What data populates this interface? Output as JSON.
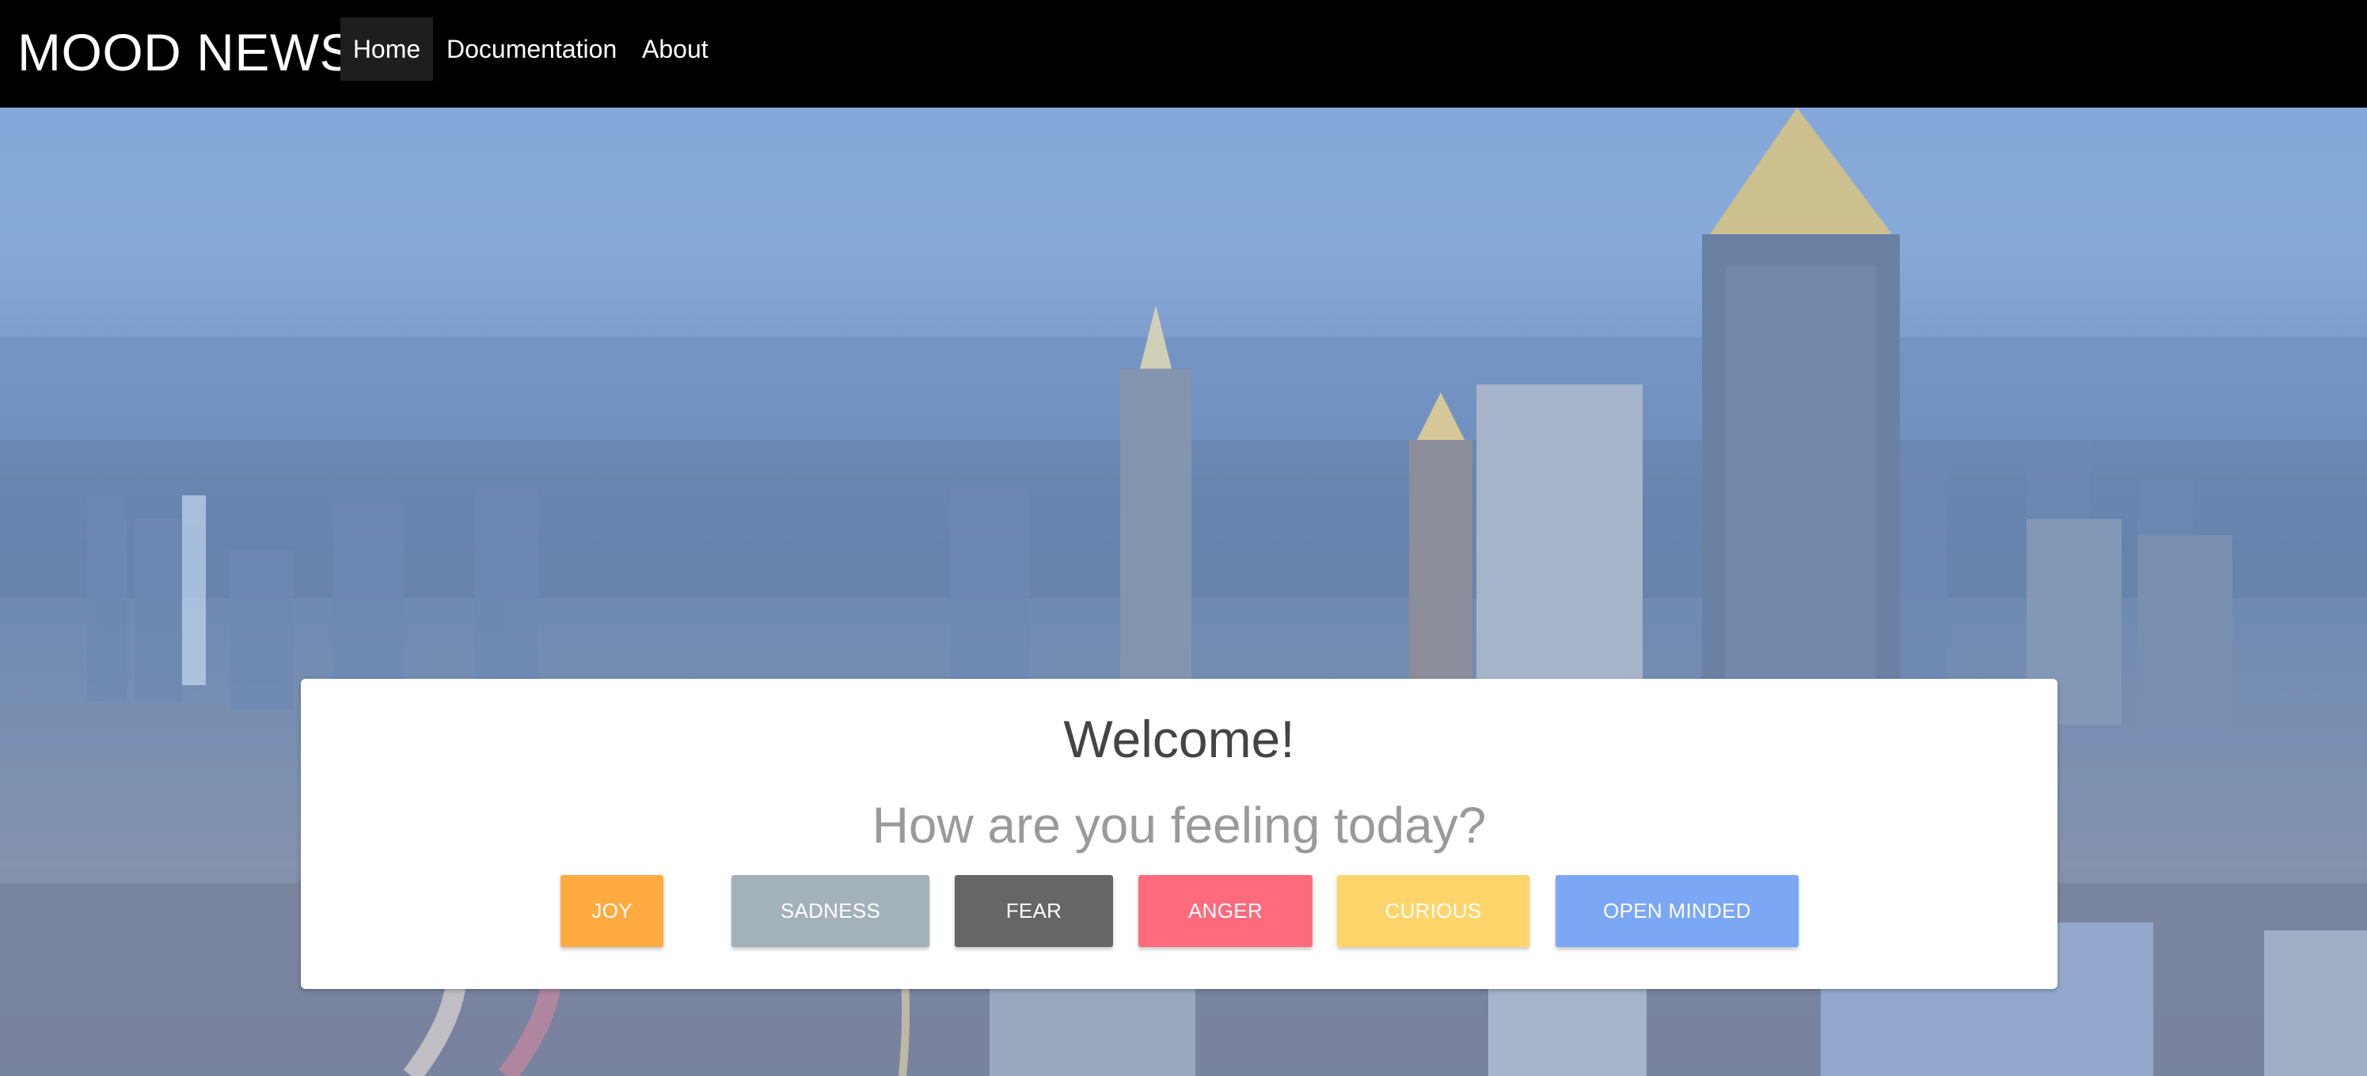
{
  "navbar": {
    "brand": "MOOD NEWS",
    "items": [
      {
        "label": "Home",
        "active": true
      },
      {
        "label": "Documentation",
        "active": false
      },
      {
        "label": "About",
        "active": false
      }
    ],
    "background": "#000000"
  },
  "hero": {
    "background_image": "city-skyline-dusk"
  },
  "card": {
    "title": "Welcome!",
    "question": "How are you feeling today?",
    "moods": [
      {
        "label": "JOY",
        "color": "#ffab40"
      },
      {
        "label": "SADNESS",
        "color": "#a3b1b9"
      },
      {
        "label": "FEAR",
        "color": "#666666"
      },
      {
        "label": "ANGER",
        "color": "#ff6b7c"
      },
      {
        "label": "CURIOUS",
        "color": "#ffd46a"
      },
      {
        "label": "OPEN MINDED",
        "color": "#7ba7f5"
      }
    ]
  }
}
